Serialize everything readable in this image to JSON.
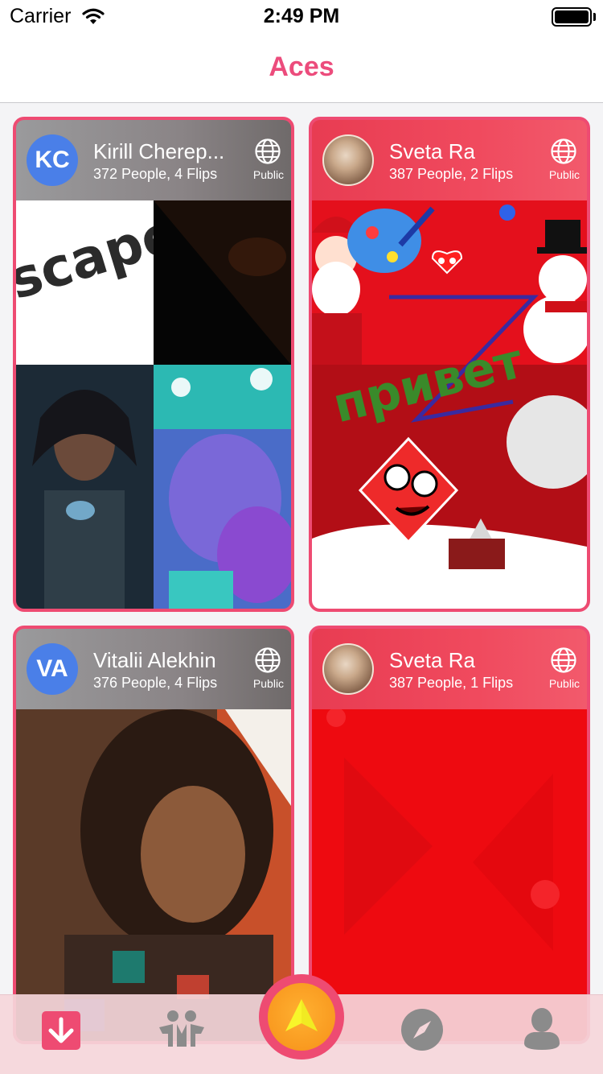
{
  "status_bar": {
    "carrier": "Carrier",
    "time": "2:49 PM"
  },
  "nav": {
    "title": "Aces"
  },
  "cards": [
    {
      "initials": "KC",
      "name": "Kirill Cherep...",
      "meta": "372 People, 4 Flips",
      "visibility": "Public",
      "header_style": "gray"
    },
    {
      "initials": "",
      "name": "Sveta Ra",
      "meta": "387 People, 2 Flips",
      "visibility": "Public",
      "header_style": "red",
      "image_text": "привет"
    },
    {
      "initials": "VA",
      "name": "Vitalii Alekhin",
      "meta": "376 People, 4 Flips",
      "visibility": "Public",
      "header_style": "gray"
    },
    {
      "initials": "",
      "name": "Sveta Ra",
      "meta": "387 People, 1 Flips",
      "visibility": "Public",
      "header_style": "red"
    }
  ],
  "tab_bar": {
    "items": [
      "download-icon",
      "people-icon",
      "flip-arrow-icon",
      "compass-icon",
      "profile-icon"
    ],
    "accent": "#ee4b72"
  },
  "colors": {
    "accent": "#ee4b72",
    "title": "#ec4c7c",
    "avatar_blue": "#4a7fe8",
    "orange": "#f99a20"
  }
}
